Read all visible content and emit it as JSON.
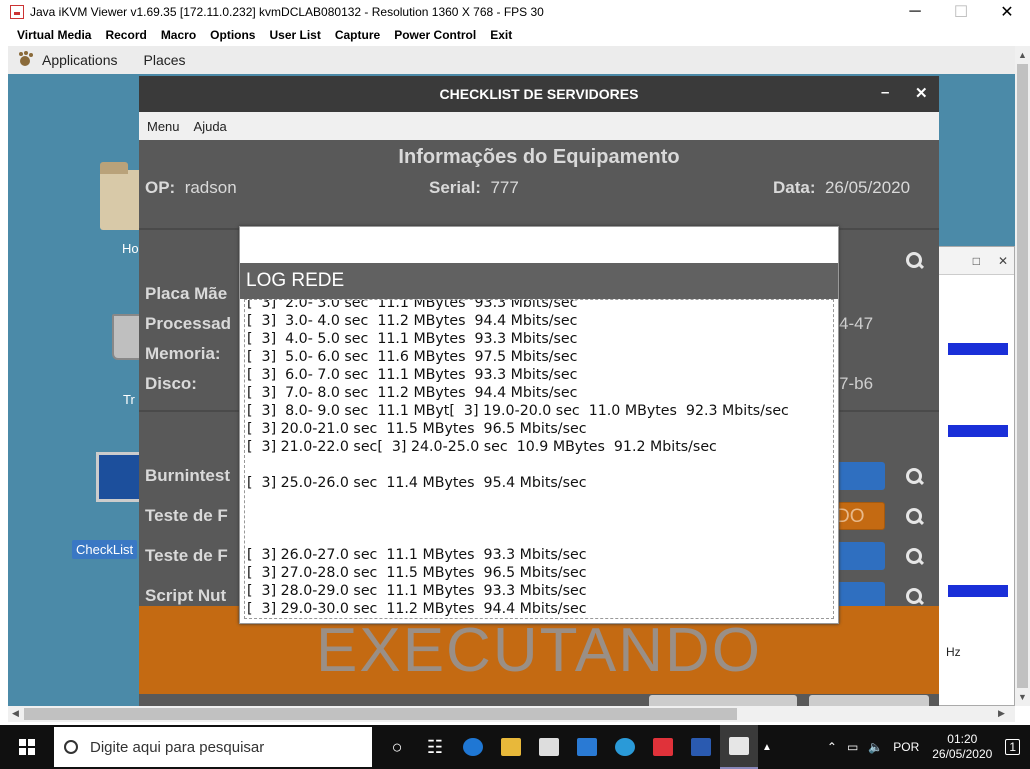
{
  "window": {
    "title": "Java iKVM Viewer v1.69.35 [172.11.0.232] kvmDCLAB080132 - Resolution 1360 X 768 - FPS 30",
    "minimize": "─",
    "maximize": "☐",
    "close": "✕"
  },
  "menubar": [
    "Virtual Media",
    "Record",
    "Macro",
    "Options",
    "User List",
    "Capture",
    "Power Control",
    "Exit"
  ],
  "gnome": {
    "applications": "Applications",
    "places": "Places"
  },
  "desktop": {
    "home_label": "Ho",
    "trash_label": "Tr",
    "checklist_label": "CheckList"
  },
  "bg_window": {
    "maximize": "□",
    "close": "✕",
    "ghz": "Hz"
  },
  "app": {
    "title": "CHECKLIST DE SERVIDORES",
    "minimize": "–",
    "close": "✕",
    "menu": [
      "Menu",
      "Ajuda"
    ],
    "info_title": "Informações do Equipamento",
    "op_label": "OP:",
    "op_value": "radson",
    "serial_label": "Serial:",
    "serial_value": "777",
    "data_label": "Data:",
    "data_value": "26/05/2020",
    "labels": {
      "placa": "Placa Mãe",
      "processador": "Processad",
      "memoria": "Memoria:",
      "disco": "Disco:",
      "burnin": "Burnintest",
      "teste1": "Teste de F",
      "teste2": "Teste de F",
      "script": "Script Nut"
    },
    "right_values": {
      "processador": "4-47",
      "disco": "7-b6",
      "teste1_btn": "DO"
    },
    "status": "EXECUTANDO"
  },
  "dialog": {
    "header": "LOG REDE",
    "log_lines": [
      "[  3]  2.0- 3.0 sec  11.1 MBytes  93.3 Mbits/sec",
      "[  3]  3.0- 4.0 sec  11.2 MBytes  94.4 Mbits/sec",
      "[  3]  4.0- 5.0 sec  11.1 MBytes  93.3 Mbits/sec",
      "[  3]  5.0- 6.0 sec  11.6 MBytes  97.5 Mbits/sec",
      "[  3]  6.0- 7.0 sec  11.1 MBytes  93.3 Mbits/sec",
      "[  3]  7.0- 8.0 sec  11.2 MBytes  94.4 Mbits/sec",
      "[  3]  8.0- 9.0 sec  11.1 MByt[  3] 19.0-20.0 sec  11.0 MBytes  92.3 Mbits/sec",
      "[  3] 20.0-21.0 sec  11.5 MBytes  96.5 Mbits/sec",
      "[  3] 21.0-22.0 sec[  3] 24.0-25.0 sec  10.9 MBytes  91.2 Mbits/sec",
      "",
      "[  3] 25.0-26.0 sec  11.4 MBytes  95.4 Mbits/sec",
      "",
      "",
      "",
      "[  3] 26.0-27.0 sec  11.1 MBytes  93.3 Mbits/sec",
      "[  3] 27.0-28.0 sec  11.5 MBytes  96.5 Mbits/sec",
      "[  3] 28.0-29.0 sec  11.1 MBytes  93.3 Mbits/sec",
      "[  3] 29.0-30.0 sec  11.2 MBytes  94.4 Mbits/sec"
    ]
  },
  "taskbar": {
    "search_placeholder": "Digite aqui para pesquisar",
    "lang": "POR",
    "time": "01:20",
    "date": "26/05/2020",
    "notif_count": "1"
  },
  "colors": {
    "app_bg": "#595959",
    "status_bg": "#c46a12",
    "field_blue": "#2f6fc0",
    "field_orange": "#c46a12"
  }
}
